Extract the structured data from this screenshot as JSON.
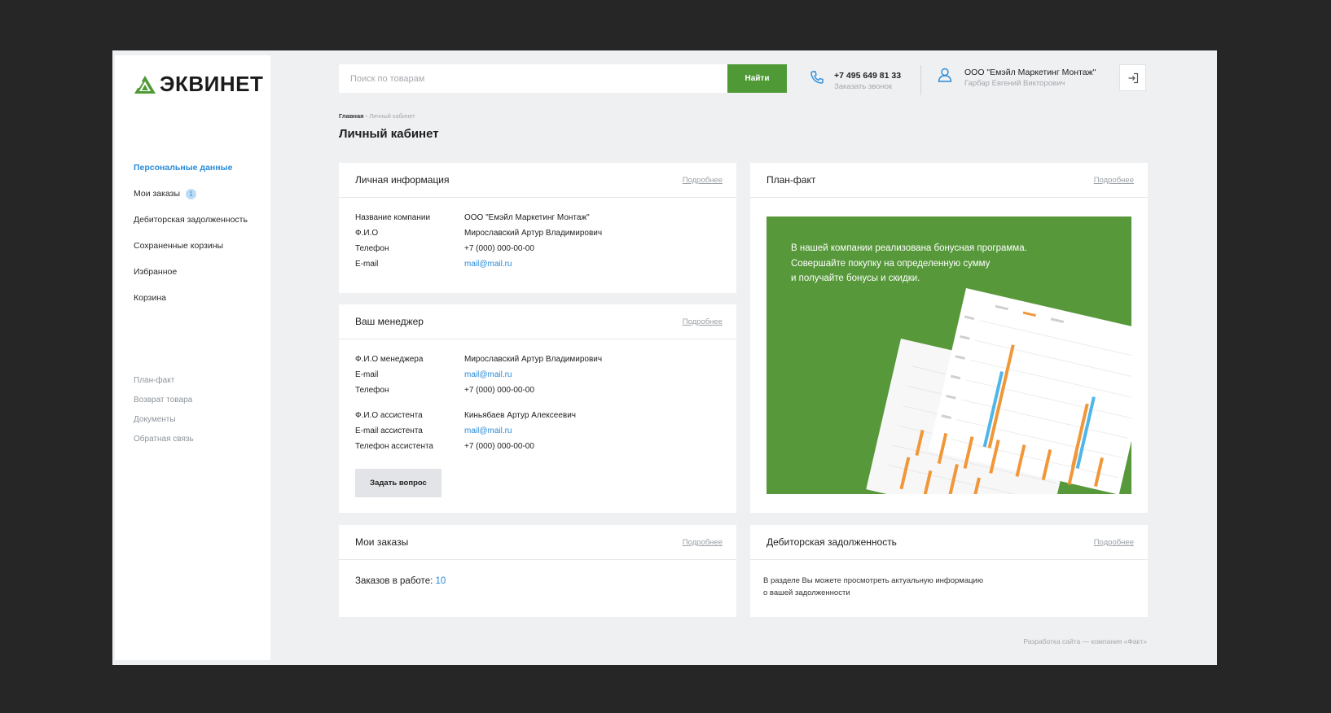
{
  "logo": {
    "text": "ЭКВИНЕТ",
    "icon": "ekvinet-logo-icon",
    "color": "#4f9a36"
  },
  "sidebar": {
    "items": [
      {
        "label": "Персональные данные",
        "active": true
      },
      {
        "label": "Мои заказы",
        "badge": "1"
      },
      {
        "label": "Дебиторская задолженность"
      },
      {
        "label": "Сохраненные корзины"
      },
      {
        "label": "Избранное"
      },
      {
        "label": "Корзина"
      }
    ],
    "secondary": [
      "План-факт",
      "Возврат товара",
      "Документы",
      "Обратная связь"
    ]
  },
  "header": {
    "search_placeholder": "Поиск по товарам",
    "search_button": "Найти",
    "phone": "+7 495 649 81 33",
    "callback": "Заказать звонок",
    "company": "ООО \"Емэйл Маркетинг Монтаж\"",
    "user_name": "Гарбар Евгений Викторович"
  },
  "breadcrumb": {
    "home": "Главная",
    "sep": " - ",
    "current": "Личный кабинет"
  },
  "page_title": "Личный кабинет",
  "more_label": "Подробнее",
  "personal_info": {
    "title": "Личная информация",
    "rows": [
      {
        "label": "Название компании",
        "value": "ООО \"Емэйл Маркетинг Монтаж\""
      },
      {
        "label": "Ф.И.О",
        "value": "Мирославский Артур Владимирович"
      },
      {
        "label": "Телефон",
        "value": "+7 (000) 000-00-00"
      },
      {
        "label": "E-mail",
        "value": "mail@mail.ru",
        "link": true
      }
    ]
  },
  "manager": {
    "title": "Ваш менеджер",
    "rows": [
      {
        "label": "Ф.И.О менеджера",
        "value": "Мирославский Артур Владимирович"
      },
      {
        "label": "E-mail",
        "value": "mail@mail.ru",
        "link": true
      },
      {
        "label": "Телефон",
        "value": "+7 (000) 000-00-00"
      }
    ],
    "assistant_rows": [
      {
        "label": "Ф.И.О ассистента",
        "value": "Киньябаев Артур Алексеевич"
      },
      {
        "label": "E-mail ассистента",
        "value": "mail@mail.ru",
        "link": true
      },
      {
        "label": "Телефон ассистента",
        "value": "+7 (000) 000-00-00"
      }
    ],
    "ask_button": "Задать вопрос"
  },
  "plan_fact": {
    "title": "План-факт",
    "promo_lines": [
      "В нашей компании реализована бонусная программа.",
      "Совершайте покупку на определенную сумму",
      "и получайте бонусы и скидки."
    ],
    "promo_bg": "#57983a"
  },
  "orders": {
    "title": "Мои заказы",
    "label": "Заказов в работе:",
    "count": "10"
  },
  "debt": {
    "title": "Дебиторская задолженность",
    "text_lines": [
      "В разделе Вы можете просмотреть актуальную информацию",
      "о вашей задолженности"
    ]
  },
  "footer": {
    "credit": "Разработка сайта — компания «Факт»"
  },
  "colors": {
    "accent_green": "#4f9a36",
    "link_blue": "#2a8bd8",
    "frame_bg": "#eef0f2",
    "outer_bg": "#262626"
  }
}
